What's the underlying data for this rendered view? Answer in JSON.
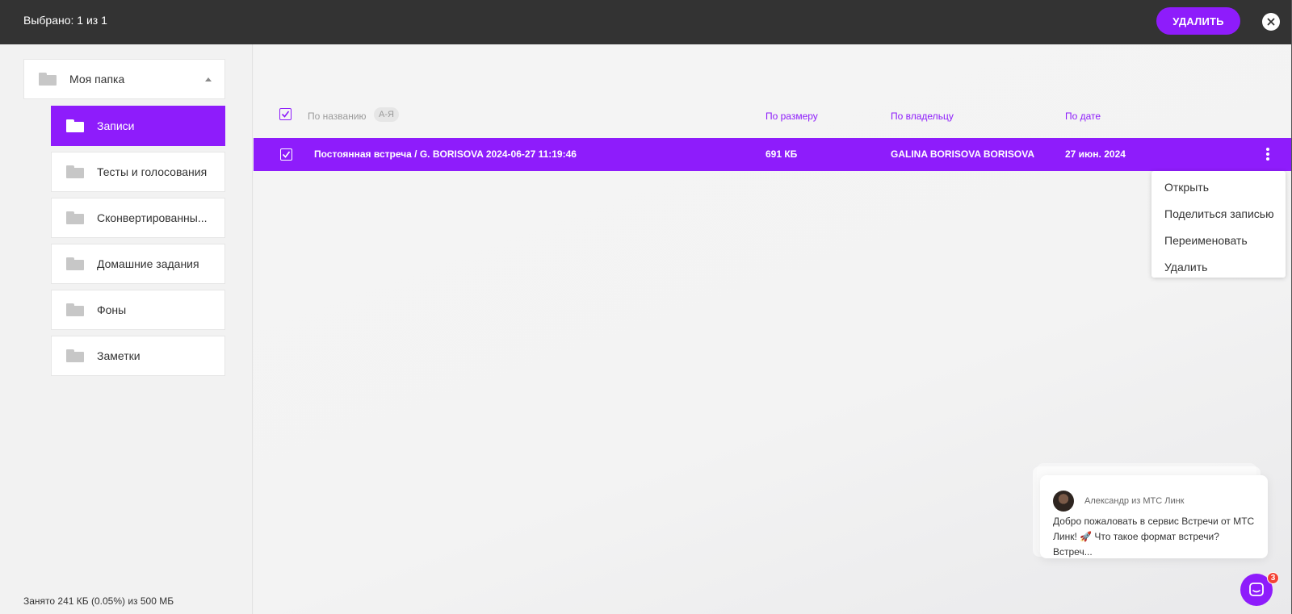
{
  "topbar": {
    "selection_text": "Выбрано: 1 из 1",
    "delete_label": "УДАЛИТЬ",
    "close_icon": "close-icon"
  },
  "sidebar": {
    "root_folder": "Моя папка",
    "folders": [
      {
        "label": "Записи",
        "active": true
      },
      {
        "label": "Тесты и голосования",
        "active": false
      },
      {
        "label": "Сконвертированны...",
        "active": false
      },
      {
        "label": "Домашние задания",
        "active": false
      },
      {
        "label": "Фоны",
        "active": false
      },
      {
        "label": "Заметки",
        "active": false
      }
    ],
    "storage": "Занято 241 КБ (0.05%) из 500 МБ"
  },
  "table": {
    "headers": {
      "name": "По названию",
      "sort": "А-Я",
      "size": "По размеру",
      "owner": "По владельцу",
      "date": "По дате"
    },
    "rows": [
      {
        "name": "Постоянная встреча / G. BORISOVA 2024-06-27 11:19:46",
        "size": "691 КБ",
        "owner": "GALINA BORISOVA BORISOVA",
        "date": "27 июн. 2024",
        "selected": true
      }
    ]
  },
  "context_menu": {
    "items": [
      "Открыть",
      "Поделиться записью",
      "Переименовать",
      "Удалить"
    ]
  },
  "chat": {
    "from": "Александр из МТС Линк",
    "message": "Добро пожаловать в сервис Встречи от МТС Линк! 🚀 Что такое формат встречи? Встреч...",
    "badge": "3"
  },
  "colors": {
    "accent": "#8e1cfb",
    "topbar": "#333333",
    "badge": "#f44336"
  }
}
